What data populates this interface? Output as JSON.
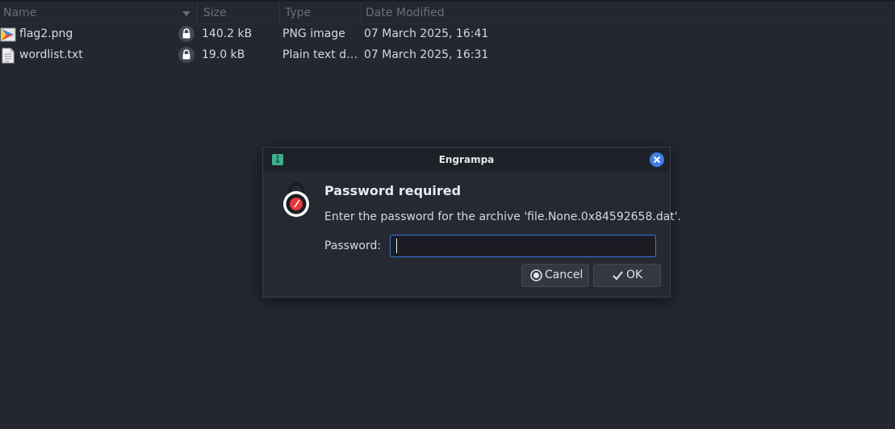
{
  "file_list": {
    "columns": {
      "name": "Name",
      "size": "Size",
      "type": "Type",
      "date_modified": "Date Modified"
    },
    "rows": [
      {
        "name": "flag2.png",
        "size": "140.2 kB",
        "type": "PNG image",
        "date_modified": "07 March 2025, 16:41",
        "icon": "image-file-icon",
        "locked": true
      },
      {
        "name": "wordlist.txt",
        "size": "19.0 kB",
        "type": "Plain text d…",
        "date_modified": "07 March 2025, 16:31",
        "icon": "text-file-icon",
        "locked": true
      }
    ]
  },
  "dialog": {
    "title": "Engrampa",
    "heading": "Password required",
    "message": "Enter the password for the archive 'file.None.0x84592658.dat'.",
    "password_label": "Password:",
    "password_value": "",
    "cancel_label": "Cancel",
    "ok_label": "OK"
  },
  "colors": {
    "background": "#242631",
    "accent": "#3f7de4",
    "lock_badge": "#e8383d"
  }
}
